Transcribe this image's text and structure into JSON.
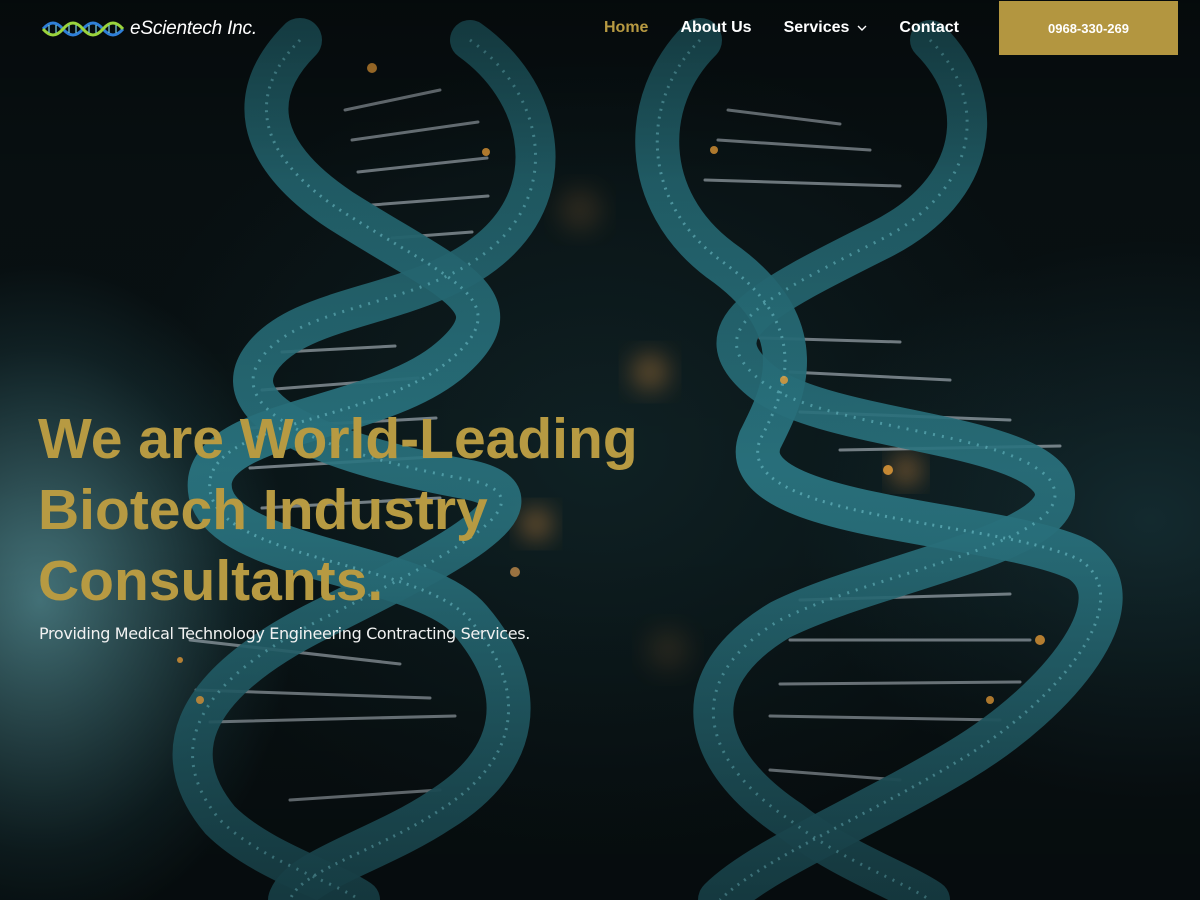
{
  "brand": {
    "name": "eScientech Inc.",
    "logo_icon": "dna-strand-logo-icon",
    "accent_color": "#b39640"
  },
  "nav": {
    "items": [
      {
        "label": "Home",
        "active": true
      },
      {
        "label": "About Us",
        "active": false
      },
      {
        "label": "Services",
        "active": false,
        "has_dropdown": true,
        "icon": "chevron-down-icon"
      },
      {
        "label": "Contact",
        "active": false
      }
    ],
    "phone_button": "0968-330-269"
  },
  "hero": {
    "title_lines": [
      "We are World-Leading",
      "Biotech Industry",
      "Consultants."
    ],
    "subtitle": "Providing Medical Technology Engineering Contracting Services.",
    "background_image": "dna-double-helix-illustration",
    "title_color": "#b79a42"
  }
}
